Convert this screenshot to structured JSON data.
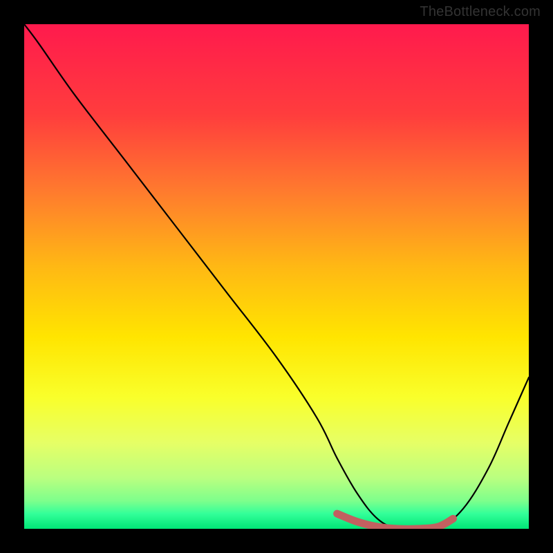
{
  "watermark": "TheBottleneck.com",
  "chart_data": {
    "type": "line",
    "title": "",
    "xlabel": "",
    "ylabel": "",
    "xlim": [
      0,
      100
    ],
    "ylim": [
      0,
      100
    ],
    "series": [
      {
        "name": "bottleneck-curve",
        "x": [
          0,
          3,
          10,
          20,
          30,
          40,
          50,
          58,
          62,
          66,
          70,
          74,
          78,
          82,
          87,
          92,
          96,
          100
        ],
        "values": [
          100,
          96,
          86,
          73,
          60,
          47,
          34,
          22,
          14,
          7,
          2,
          0,
          0,
          0,
          4,
          12,
          21,
          30
        ]
      },
      {
        "name": "optimal-segment",
        "x": [
          62,
          66,
          70,
          74,
          78,
          82,
          85
        ],
        "values": [
          3,
          1.4,
          0.4,
          0,
          0,
          0.4,
          2
        ]
      }
    ],
    "gradient_stops": [
      {
        "offset": 0,
        "color": "#ff1a4d"
      },
      {
        "offset": 18,
        "color": "#ff3d3d"
      },
      {
        "offset": 33,
        "color": "#ff7a2e"
      },
      {
        "offset": 48,
        "color": "#ffb814"
      },
      {
        "offset": 62,
        "color": "#ffe500"
      },
      {
        "offset": 74,
        "color": "#f9ff2b"
      },
      {
        "offset": 83,
        "color": "#e6ff66"
      },
      {
        "offset": 90,
        "color": "#b9ff80"
      },
      {
        "offset": 94.5,
        "color": "#7dff8c"
      },
      {
        "offset": 97,
        "color": "#33ff99"
      },
      {
        "offset": 100,
        "color": "#00e676"
      }
    ],
    "curve_style": {
      "stroke": "#000000",
      "width": 2.2
    },
    "segment_style": {
      "stroke": "#c26060",
      "width": 11,
      "linecap": "round"
    }
  }
}
